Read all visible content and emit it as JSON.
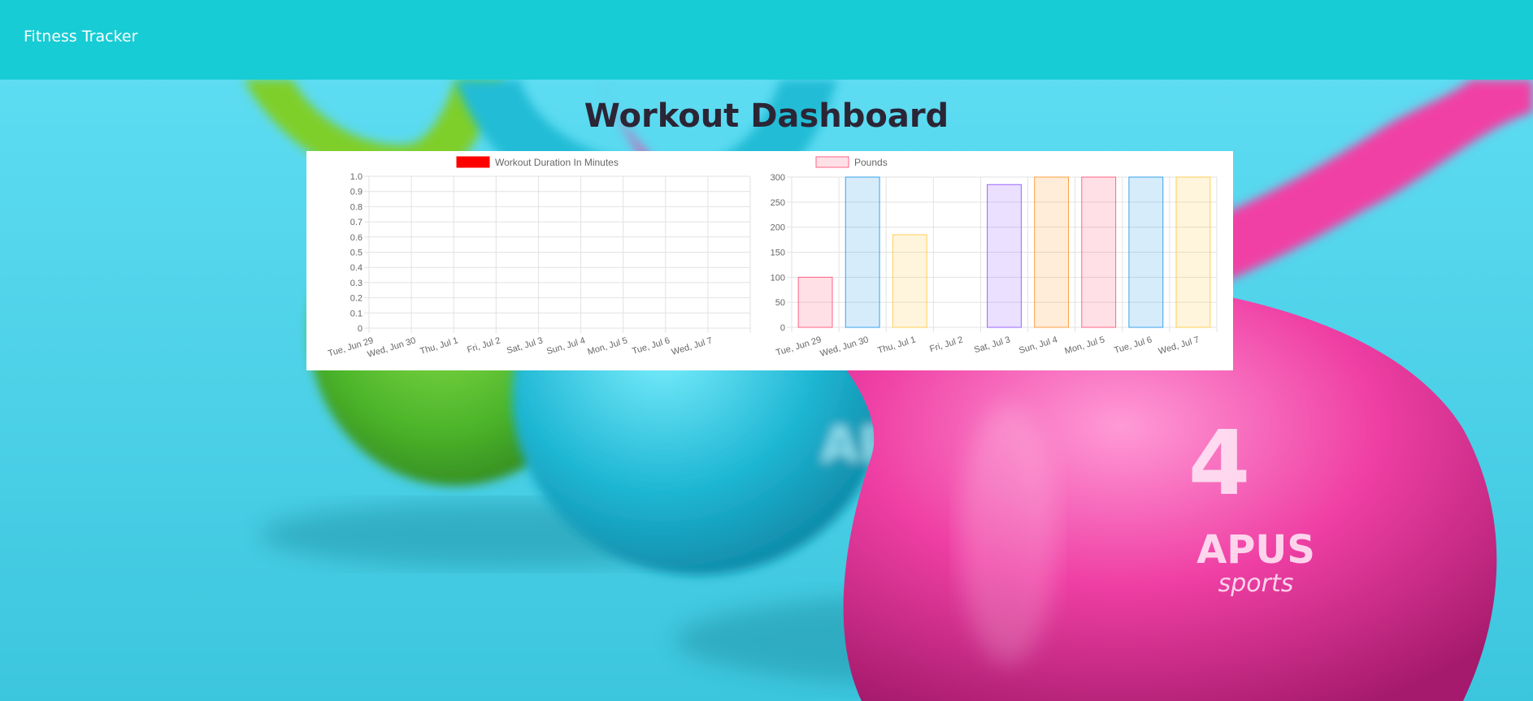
{
  "navbar": {
    "brand": "Fitness Tracker"
  },
  "page": {
    "title": "Workout Dashboard"
  },
  "hero": {
    "brand_text_1": "APUS",
    "brand_text_2": "sports",
    "weight_label": "4"
  },
  "colors": {
    "navbar": "#17ccd4",
    "title": "#2b2535",
    "grid": "#e2e2e2",
    "axis_text": "#666666"
  },
  "chart_data": [
    {
      "type": "line",
      "legend": [
        {
          "name": "Workout Duration In Minutes",
          "color": "#ff0000"
        }
      ],
      "categories": [
        "Tue, Jun 29",
        "Wed, Jun 30",
        "Thu, Jul 1",
        "Fri, Jul 2",
        "Sat, Jul 3",
        "Sun, Jul 4",
        "Mon, Jul 5",
        "Tue, Jul 6",
        "Wed, Jul 7"
      ],
      "series": [
        {
          "name": "Workout Duration In Minutes",
          "values": []
        }
      ],
      "y_ticks": [
        "0",
        "0.1",
        "0.2",
        "0.3",
        "0.4",
        "0.5",
        "0.6",
        "0.7",
        "0.8",
        "0.9",
        "1.0"
      ],
      "ylim": [
        0,
        1.0
      ],
      "grid": true,
      "legend_position": "top"
    },
    {
      "type": "bar",
      "legend": [
        {
          "name": "Pounds",
          "color": "#ff6384"
        }
      ],
      "categories": [
        "Tue, Jun 29",
        "Wed, Jun 30",
        "Thu, Jul 1",
        "Fri, Jul 2",
        "Sat, Jul 3",
        "Sun, Jul 4",
        "Mon, Jul 5",
        "Tue, Jul 6",
        "Wed, Jul 7"
      ],
      "series": [
        {
          "name": "Pounds",
          "values": [
            100,
            300,
            185,
            0,
            285,
            300,
            300,
            300,
            300
          ]
        }
      ],
      "bar_colors": [
        {
          "fill": "rgba(255,99,132,0.2)",
          "stroke": "#ff6384"
        },
        {
          "fill": "rgba(54,162,235,0.2)",
          "stroke": "#36a2eb"
        },
        {
          "fill": "rgba(255,206,86,0.2)",
          "stroke": "#ffce56"
        },
        {
          "fill": "rgba(75,192,192,0.2)",
          "stroke": "#4bc0c0"
        },
        {
          "fill": "rgba(153,102,255,0.2)",
          "stroke": "#9966ff"
        },
        {
          "fill": "rgba(255,159,64,0.2)",
          "stroke": "#ff9f40"
        },
        {
          "fill": "rgba(255,99,132,0.2)",
          "stroke": "#ff6384"
        },
        {
          "fill": "rgba(54,162,235,0.2)",
          "stroke": "#36a2eb"
        },
        {
          "fill": "rgba(255,206,86,0.2)",
          "stroke": "#ffce56"
        }
      ],
      "y_ticks": [
        "0",
        "50",
        "100",
        "150",
        "200",
        "250",
        "300"
      ],
      "ylim": [
        0,
        300
      ],
      "grid": true,
      "legend_position": "top"
    }
  ]
}
